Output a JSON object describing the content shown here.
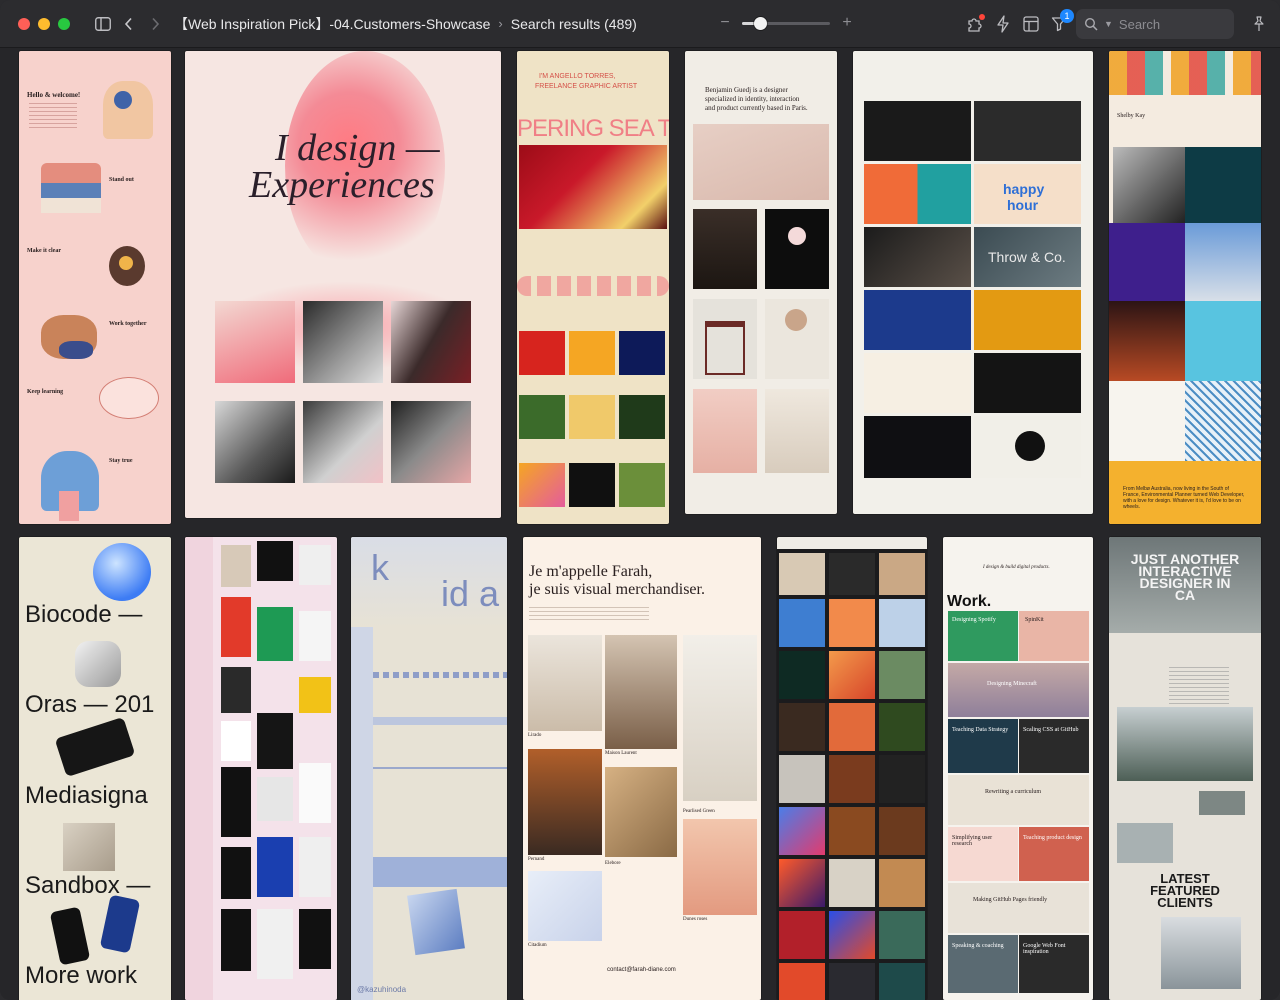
{
  "window": {
    "path_title": "【Web Inspiration Pick】-04.Customers-Showcase",
    "path_sub": "Search results (489)",
    "zoom_value": 0.2
  },
  "toolbar": {
    "search_placeholder": "Search",
    "filter_badge": "1"
  },
  "icons": {
    "sidebar": "sidebar-toggle-icon",
    "back": "chevron-left-icon",
    "forward": "chevron-right-icon",
    "zoom_out": "minus-icon",
    "zoom_in": "plus-icon",
    "extensions": "puzzle-icon",
    "lightning": "lightning-icon",
    "layout": "layout-icon",
    "filter": "filter-icon",
    "search": "search-icon",
    "pin": "pin-icon"
  },
  "colors": {
    "accent": "#1e88ff",
    "titlebar": "#2c2c2f",
    "background": "#262629"
  },
  "cards": {
    "c1": {
      "t1": "Hello & welcome!",
      "t2": "Stand out",
      "t3": "Make it clear",
      "t4": "Work together",
      "t5": "Keep learning",
      "t6": "Stay true"
    },
    "c2": {
      "h1": "I design —",
      "h2": "Experiences"
    },
    "c3": {
      "h1": "I'M ANGELLO TORRES,",
      "h2": "FREELANCE GRAPHIC ARTIST",
      "band": "PERING SEA TI"
    },
    "c4": {
      "h1": "Benjamin Guedj is a designer",
      "h2": "specialized in identity, interaction",
      "h3": "and product currently based in Paris."
    },
    "c5": {
      "happy": "happy",
      "hour": "hour",
      "throw": "Throw & Co."
    },
    "c6": {
      "name": "Shelby Kay",
      "bottom": "From Melbø Australia, now living in the South of France, Environmental Planner turned Web Developer, with a love for design. Whatever it is, I'd love to be on wheels."
    },
    "c7": {
      "w1": "Biocode —",
      "w2": "Oras — 201",
      "w3": "Mediasigna",
      "w4": "Sandbox —",
      "w5": "More work"
    },
    "c9": {
      "credit": "@kazuhinoda"
    },
    "c10": {
      "h1": "Je m'appelle Farah,",
      "h2": "je suis visual merchandiser.",
      "l1": "Lirado",
      "l2": "Maison Laurent",
      "l3": "Pearlised Green",
      "l4": "Pernand",
      "l5": "Elebore",
      "l6": "Dunes roses",
      "l7": "Citadium",
      "email": "contact@farah-diane.com"
    },
    "c12": {
      "intro": "I design & build digital products.",
      "work": "Work.",
      "p1": "Designing Spotify",
      "p2": "SpinKit",
      "p3": "Designing Minecraft",
      "p4": "Teaching Data Strategy",
      "p5": "Scaling CSS at GitHub",
      "p6": "Rewriting a curriculum",
      "p7": "Simplifying user research",
      "p8": "Teaching product design",
      "p9": "Making GitHub Pages friendly",
      "p10": "Speaking & coaching",
      "p11": "Google Web Font inspiration"
    },
    "c13": {
      "h": "JUST ANOTHER INTERACTIVE DESIGNER IN CA",
      "bottom": "LATEST FEATURED CLIENTS"
    }
  }
}
